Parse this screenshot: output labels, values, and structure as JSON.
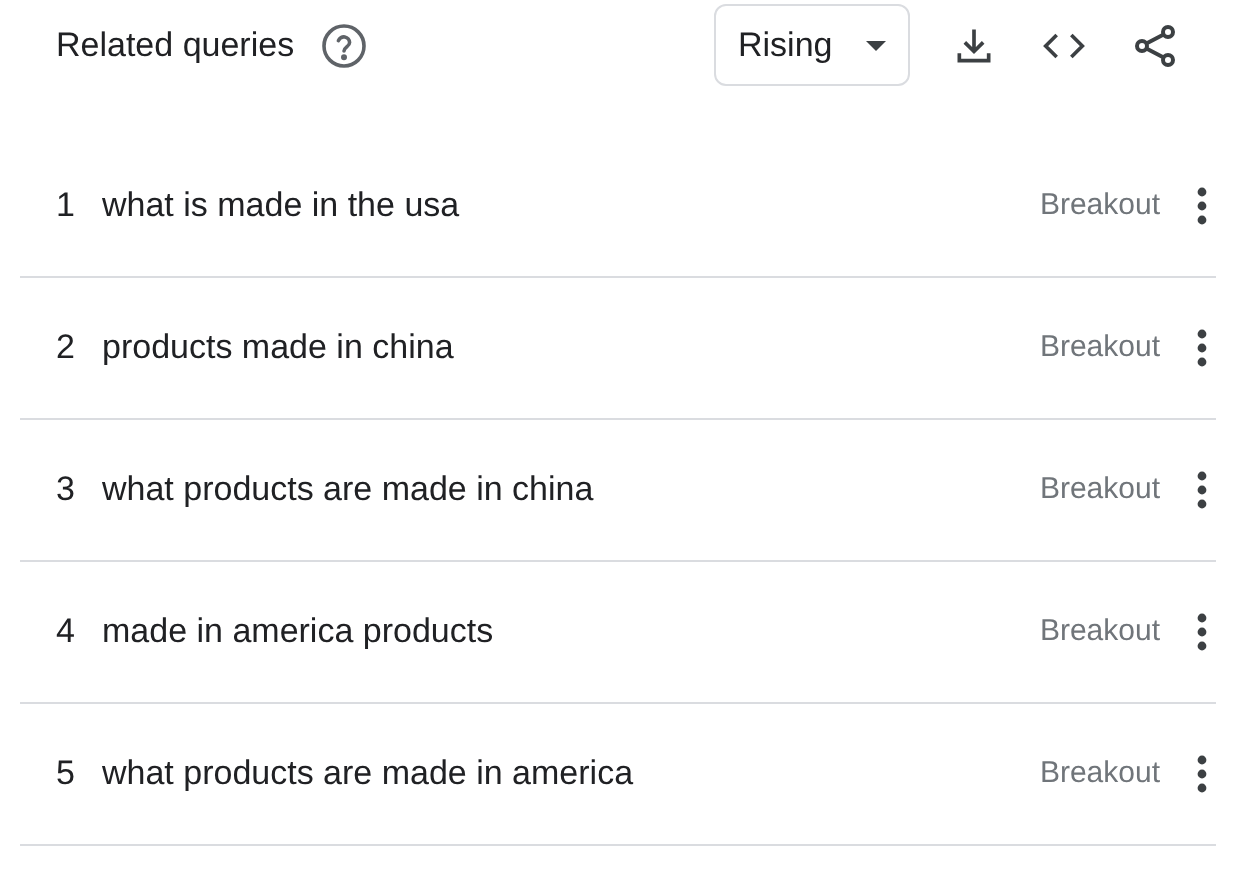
{
  "title": "Related queries",
  "dropdown": {
    "value": "Rising"
  },
  "rows": [
    {
      "rank": "1",
      "query": "what is made in the usa",
      "value": "Breakout"
    },
    {
      "rank": "2",
      "query": "products made in china",
      "value": "Breakout"
    },
    {
      "rank": "3",
      "query": "what products are made in china",
      "value": "Breakout"
    },
    {
      "rank": "4",
      "query": "made in america products",
      "value": "Breakout"
    },
    {
      "rank": "5",
      "query": "what products are made in america",
      "value": "Breakout"
    }
  ]
}
